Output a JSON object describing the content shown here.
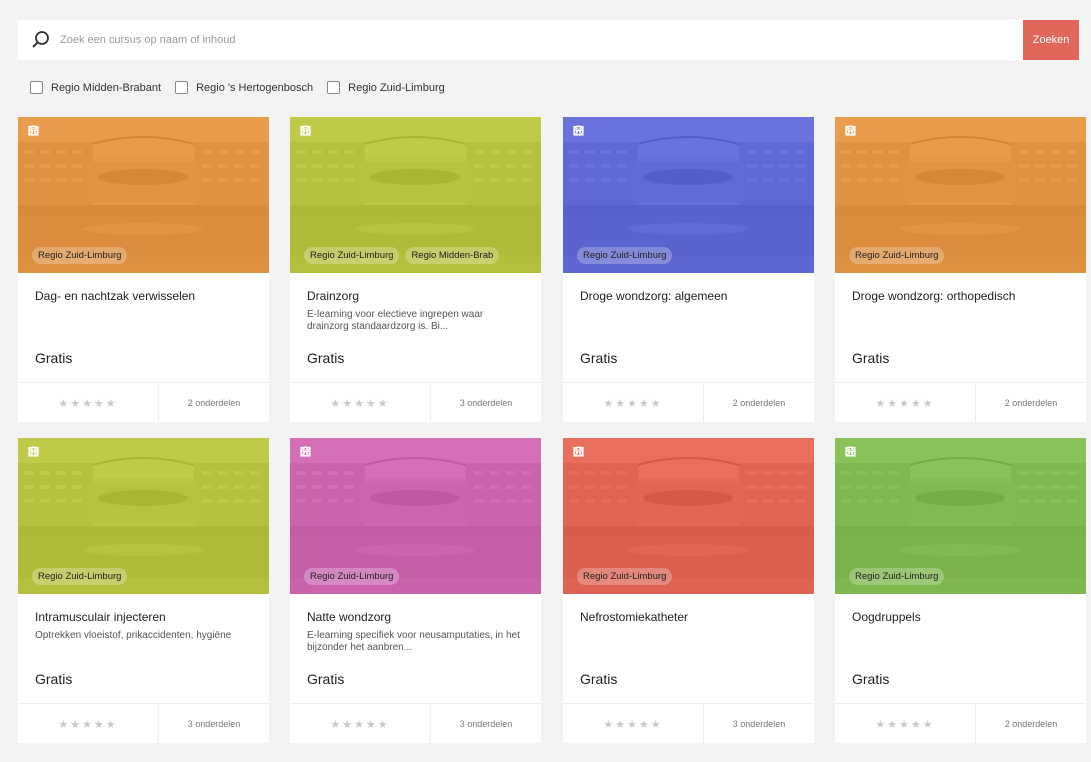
{
  "search": {
    "placeholder": "Zoek een cursus op naam of inhoud",
    "button_label": "Zoeken",
    "button_color": "#e0675a"
  },
  "filters": [
    {
      "label": "Regio Midden-Brabant",
      "checked": false
    },
    {
      "label": "Regio 's Hertogenbosch",
      "checked": false
    },
    {
      "label": "Regio Zuid-Limburg",
      "checked": false
    }
  ],
  "cards": [
    {
      "title": "Dag- en nachtzak verwisselen",
      "description": "",
      "price": "Gratis",
      "rating": "★★★★★",
      "parts": "2 onderdelen",
      "tags": [
        "Regio Zuid-Limburg"
      ],
      "color": "#e8851f",
      "icons": [
        "globe-icon",
        "calendar-icon"
      ]
    },
    {
      "title": "Drainzorg",
      "description": "E-learning voor electieve ingrepen waar drainzorg standaardzorg is. Bi...",
      "price": "Gratis",
      "rating": "★★★★★",
      "parts": "3 onderdelen",
      "tags": [
        "Regio Zuid-Limburg",
        "Regio Midden-Brab"
      ],
      "color": "#b2c21a",
      "icons": [
        "globe-icon",
        "calendar-icon"
      ]
    },
    {
      "title": "Droge wondzorg: algemeen",
      "description": "",
      "price": "Gratis",
      "rating": "★★★★★",
      "parts": "2 onderdelen",
      "tags": [
        "Regio Zuid-Limburg"
      ],
      "color": "#4450d8",
      "icons": [
        "globe-icon",
        "calendar-icon"
      ]
    },
    {
      "title": "Droge wondzorg: orthopedisch",
      "description": "",
      "price": "Gratis",
      "rating": "★★★★★",
      "parts": "2 onderdelen",
      "tags": [
        "Regio Zuid-Limburg"
      ],
      "color": "#e8851f",
      "icons": [
        "globe-icon",
        "calendar-icon"
      ]
    },
    {
      "title": "Intramusculair injecteren",
      "description": "Optrekken vloeistof, prikaccidenten, hygiëne",
      "price": "Gratis",
      "rating": "★★★★★",
      "parts": "3 onderdelen",
      "tags": [
        "Regio Zuid-Limburg"
      ],
      "color": "#b2c21a",
      "icons": [
        "globe-icon",
        "calendar-icon"
      ]
    },
    {
      "title": "Natte wondzorg",
      "description": "E-learning specifiek voor neusamputaties, in het bijzonder het aanbren...",
      "price": "Gratis",
      "rating": "★★★★★",
      "parts": "3 onderdelen",
      "tags": [
        "Regio Zuid-Limburg"
      ],
      "color": "#cc4aa8",
      "icons": [
        "globe-icon",
        "calendar-icon"
      ]
    },
    {
      "title": "Nefrostomiekatheter",
      "description": "",
      "price": "Gratis",
      "rating": "★★★★★",
      "parts": "3 onderdelen",
      "tags": [
        "Regio Zuid-Limburg"
      ],
      "color": "#e84a34",
      "icons": [
        "globe-icon",
        "calendar-icon"
      ]
    },
    {
      "title": "Oogdruppels",
      "description": "",
      "price": "Gratis",
      "rating": "★★★★★",
      "parts": "2 onderdelen",
      "tags": [
        "Regio Zuid-Limburg"
      ],
      "color": "#6cb62e",
      "icons": [
        "globe-icon",
        "calendar-icon"
      ]
    }
  ]
}
